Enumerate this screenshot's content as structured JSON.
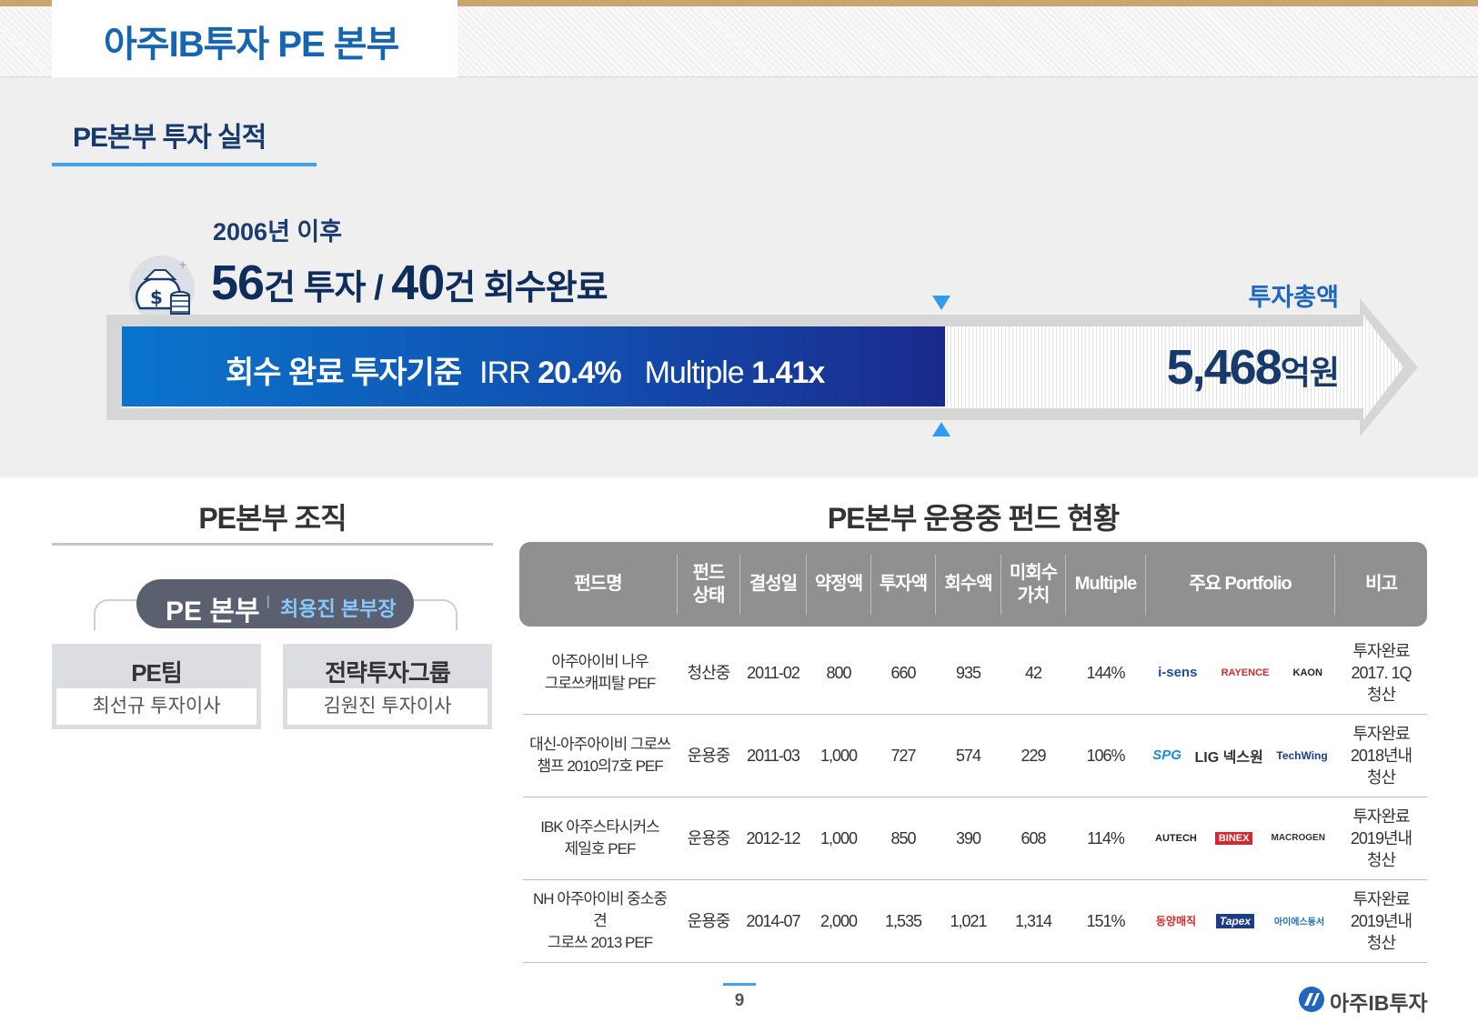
{
  "header": {
    "title": "아주IB투자 PE 본부"
  },
  "performance": {
    "section_title": "PE본부 투자 실적",
    "since": "2006년  이후",
    "headline": {
      "invest_count": "56",
      "invest_unit": "건 투자 / ",
      "exit_count": "40",
      "exit_unit": "건 회수완료"
    },
    "bar": {
      "label": "회수 완료 투자기준",
      "irr_label": "IRR",
      "irr_value": "20.4%",
      "multiple_label": "Multiple",
      "multiple_value": "1.41x"
    },
    "total": {
      "label": "투자총액",
      "amount": "5,468",
      "unit": "억원"
    },
    "icon": "money-bag-icon"
  },
  "org": {
    "title": "PE본부 조직",
    "head": {
      "name": "PE 본부",
      "separator": "I",
      "leader": "최용진 본부장"
    },
    "teams": [
      {
        "name": "PE팀",
        "member": "최선규 투자이사"
      },
      {
        "name": "전략투자그룹",
        "member": "김원진 투자이사"
      }
    ]
  },
  "funds": {
    "title": "PE본부 운용중 펀드 현황",
    "columns": [
      "펀드명",
      "펀드\n상태",
      "결성일",
      "약정액",
      "투자액",
      "회수액",
      "미회수\n가치",
      "Multiple",
      "주요 Portfolio",
      "비고"
    ],
    "rows": [
      {
        "name": "아주아이비 나우\n그로쓰캐피탈 PEF",
        "status": "청산중",
        "date": "2011-02",
        "commit": "800",
        "invested": "660",
        "recovered": "935",
        "unrecovered": "42",
        "multiple": "144%",
        "portfolio": [
          "i-sens",
          "RAYENCE",
          "KAON"
        ],
        "note": "투자완료\n2017. 1Q\n청산"
      },
      {
        "name": "대신-아주아이비 그로쓰\n챔프 2010의7호 PEF",
        "status": "운용중",
        "date": "2011-03",
        "commit": "1,000",
        "invested": "727",
        "recovered": "574",
        "unrecovered": "229",
        "multiple": "106%",
        "portfolio": [
          "SPG",
          "LIG 넥스원",
          "TechWing"
        ],
        "note": "투자완료\n2018년내\n청산"
      },
      {
        "name": "IBK 아주스타시커스\n제일호 PEF",
        "status": "운용중",
        "date": "2012-12",
        "commit": "1,000",
        "invested": "850",
        "recovered": "390",
        "unrecovered": "608",
        "multiple": "114%",
        "portfolio": [
          "AUTECH",
          "BINEX",
          "MACROGEN"
        ],
        "note": "투자완료\n2019년내\n청산"
      },
      {
        "name": "NH 아주아이비 중소중\n견\n그로쓰 2013 PEF",
        "status": "운용중",
        "date": "2014-07",
        "commit": "2,000",
        "invested": "1,535",
        "recovered": "1,021",
        "unrecovered": "1,314",
        "multiple": "151%",
        "portfolio": [
          "동양매직",
          "Tapex",
          "아이에스동서"
        ],
        "note": "투자완료\n2019년내\n청산"
      }
    ]
  },
  "footer": {
    "page": "9",
    "brand": "아주IB투자"
  }
}
